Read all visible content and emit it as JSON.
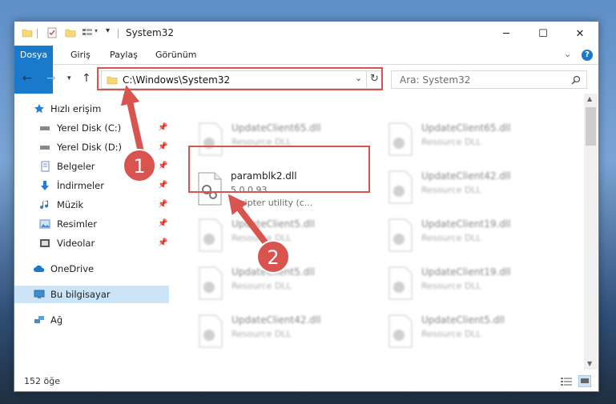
{
  "window": {
    "title": "System32"
  },
  "tabs": [
    "Dosya",
    "Giriş",
    "Paylaş",
    "Görünüm"
  ],
  "address": {
    "path": "C:\\Windows\\System32"
  },
  "search": {
    "placeholder": "Ara: System32"
  },
  "nav": [
    {
      "label": "Hızlı erişim",
      "icon": "star-icon",
      "pinned": false
    },
    {
      "label": "Yerel Disk (C:)",
      "icon": "drive-icon",
      "pinned": true
    },
    {
      "label": "Yerel Disk (D:)",
      "icon": "drive-icon",
      "pinned": true
    },
    {
      "label": "Belgeler",
      "icon": "documents-icon",
      "pinned": true
    },
    {
      "label": "İndirmeler",
      "icon": "download-icon",
      "pinned": true
    },
    {
      "label": "Müzik",
      "icon": "music-icon",
      "pinned": true
    },
    {
      "label": "Resimler",
      "icon": "pictures-icon",
      "pinned": true
    },
    {
      "label": "Videolar",
      "icon": "videos-icon",
      "pinned": true
    },
    {
      "label": "OneDrive",
      "icon": "cloud-icon",
      "pinned": false
    },
    {
      "label": "Bu bilgisayar",
      "icon": "computer-icon",
      "pinned": false,
      "selected": true
    },
    {
      "label": "Ağ",
      "icon": "network-icon",
      "pinned": false
    }
  ],
  "files": {
    "highlighted": {
      "name": "paramblk2.dll",
      "version": "5.0.0.93",
      "description": "Scripter utility (c..."
    },
    "background": [
      {
        "name": "UpdateClient65.dll",
        "type": "Resource DLL"
      },
      {
        "name": "UpdateClient65.dll",
        "type": "Resource DLL"
      },
      {
        "name": "UpdateClient42.dll",
        "type": "Resource DLL"
      },
      {
        "name": "UpdateClient5.dll",
        "type": "Resource DLL"
      },
      {
        "name": "UpdateClient19.dll",
        "type": "Resource DLL"
      },
      {
        "name": "UpdateClient5.dll",
        "type": "Resource DLL"
      },
      {
        "name": "UpdateClient19.dll",
        "type": "Resource DLL"
      },
      {
        "name": "UpdateClient42.dll",
        "type": "Resource DLL"
      },
      {
        "name": "UpdateClient5.dll",
        "type": "Resource DLL"
      }
    ]
  },
  "status": {
    "count": "152 öğe"
  },
  "annotations": {
    "step1": "1",
    "step2": "2",
    "color": "#d9534f"
  }
}
